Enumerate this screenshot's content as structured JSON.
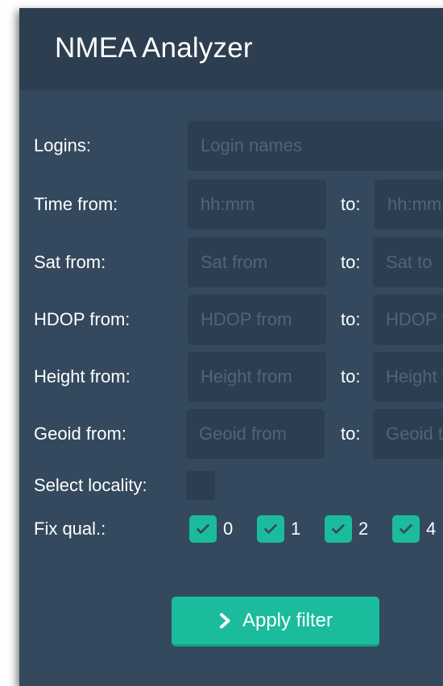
{
  "app": {
    "title": "NMEA Analyzer"
  },
  "logins": {
    "label": "Logins:",
    "placeholder": "Login names"
  },
  "ranges": [
    {
      "label": "Time from:",
      "from_placeholder": "hh:mm",
      "to_label": "to:",
      "to_placeholder": "hh:mm"
    },
    {
      "label": "Sat from:",
      "from_placeholder": "Sat from",
      "to_label": "to:",
      "to_placeholder": "Sat to"
    },
    {
      "label": "HDOP from:",
      "from_placeholder": "HDOP from",
      "to_label": "to:",
      "to_placeholder": "HDOP to"
    },
    {
      "label": "Height from:",
      "from_placeholder": "Height from",
      "to_label": "to:",
      "to_placeholder": "Height to"
    },
    {
      "label": "Geoid from:",
      "from_placeholder": "Geoid from",
      "to_label": "to:",
      "to_placeholder": "Geoid to"
    }
  ],
  "locality": {
    "label": "Select locality:",
    "checked": false
  },
  "fix_quality": {
    "label": "Fix qual.:",
    "options": [
      {
        "value": "0",
        "checked": true
      },
      {
        "value": "1",
        "checked": true
      },
      {
        "value": "2",
        "checked": true
      },
      {
        "value": "4",
        "checked": true
      }
    ]
  },
  "apply_button": {
    "label": "Apply filter",
    "icon": "chevron-right-icon"
  },
  "colors": {
    "panel": "#34495e",
    "header": "#2c3e50",
    "accent": "#1abc9c"
  }
}
